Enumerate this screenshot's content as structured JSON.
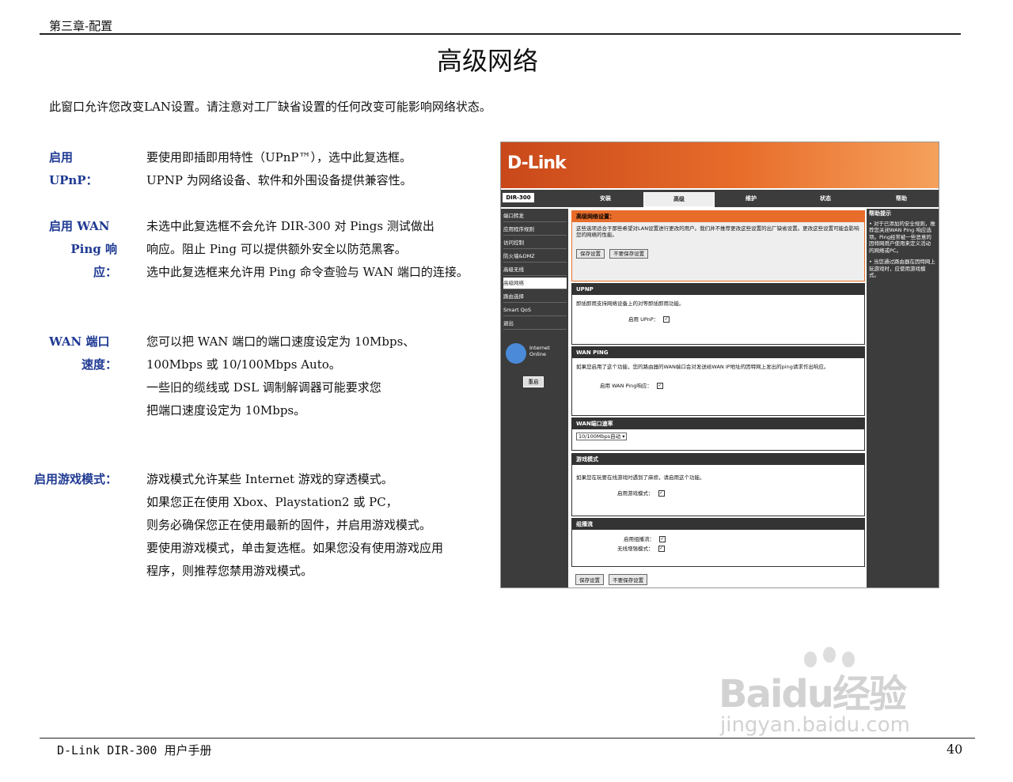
{
  "header": {
    "chapter": "第三章-配置",
    "title": "高级网络"
  },
  "intro": "此窗口允许您改变LAN设置。请注意对工厂缺省设置的任何改变可能影响网络状态。",
  "sections": [
    {
      "label_lines": [
        "启用 UPnP："
      ],
      "lines": [
        "要使用即插即用特性（UPnP™），选中此复选框。",
        "UPNP 为网络设备、软件和外围设备提供兼容性。"
      ]
    },
    {
      "label_lines": [
        "启用 WAN",
        "Ping 响应："
      ],
      "lines": [
        "未选中此复选框不会允许 DIR-300 对 Pings 测试做出",
        "响应。阻止 Ping 可以提供额外安全以防范黑客。",
        "选中此复选框来允许用 Ping 命令查验与 WAN 端口的连接。"
      ]
    },
    {
      "label_lines": [
        "WAN 端口",
        "速度："
      ],
      "lines": [
        "您可以把 WAN 端口的端口速度设定为 10Mbps、",
        "100Mbps 或 10/100Mbps Auto。",
        "一些旧的缆线或 DSL 调制解调器可能要求您",
        "把端口速度设定为 10Mbps。"
      ]
    },
    {
      "label_lines": [
        "启用游戏模式："
      ],
      "lines": [
        "游戏模式允许某些 Internet 游戏的穿透模式。",
        "如果您正在使用 Xbox、Playstation2 或 PC，",
        "则务必确保您正在使用最新的固件，并启用游戏模式。",
        "要使用游戏模式，单击复选框。如果您没有使用游戏应用",
        "程序，则推荐您禁用游戏模式。"
      ]
    }
  ],
  "screenshot": {
    "logo": "D-Link",
    "model": "DIR-300",
    "tabs": [
      "安装",
      "高级",
      "维护",
      "状态",
      "帮助"
    ],
    "sidebar": [
      "端口转发",
      "应用程序规则",
      "访问控制",
      "防火墙&DMZ",
      "高级无线",
      "高级网络",
      "路由选择",
      "Smart QoS",
      "退出"
    ],
    "internet_status": [
      "Internet",
      "Online"
    ],
    "reboot": "重启",
    "help_title": "帮助提示",
    "help_text": [
      "• 对于已添加的安全规则，推荐您关闭WAN Ping 响应选项。Ping经常被一些恶意的因特网用户使用来定义活动的网络或PC。",
      "• 当您通过路由器在因特网上玩游戏时，应使用游戏模式。"
    ],
    "adv_title": "高级网络设置：",
    "adv_text": "这些选项适合于那些希望对LAN设置进行更改的用户。我们并不推荐更改这些设置的出厂缺省设置。更改这些设置可能会影响您的网络的性能。",
    "save": "保存设置",
    "nosave": "不要保存设置",
    "upnp_title": "UPNP",
    "upnp_text": "即插即用支持网络设备上的对等即插即用功能。",
    "upnp_label": "启用 UPnP：",
    "ping_title": "WAN PING",
    "ping_text": "如果您启用了这个功能，您的路由器的WAN端口会对发送给WAN IP地址的因特网上发出的ping请求作出响应。",
    "ping_label": "启用 WAN Ping响应：",
    "speed_title": "WAN端口速率",
    "speed_value": "10/100Mbps自动",
    "game_title": "游戏模式",
    "game_text": "如果您在玩要在线游戏时遇到了麻烦，请启用这个功能。",
    "game_label": "启用游戏模式：",
    "multi_title": "组播流",
    "multi_label1": "启用组播流：",
    "multi_label2": "无线增强模式："
  },
  "watermark": {
    "main": "Baidu经验",
    "sub": "jingyan.baidu.com"
  },
  "footer": {
    "text": "D-Link DIR-300 用户手册",
    "page": "40"
  }
}
